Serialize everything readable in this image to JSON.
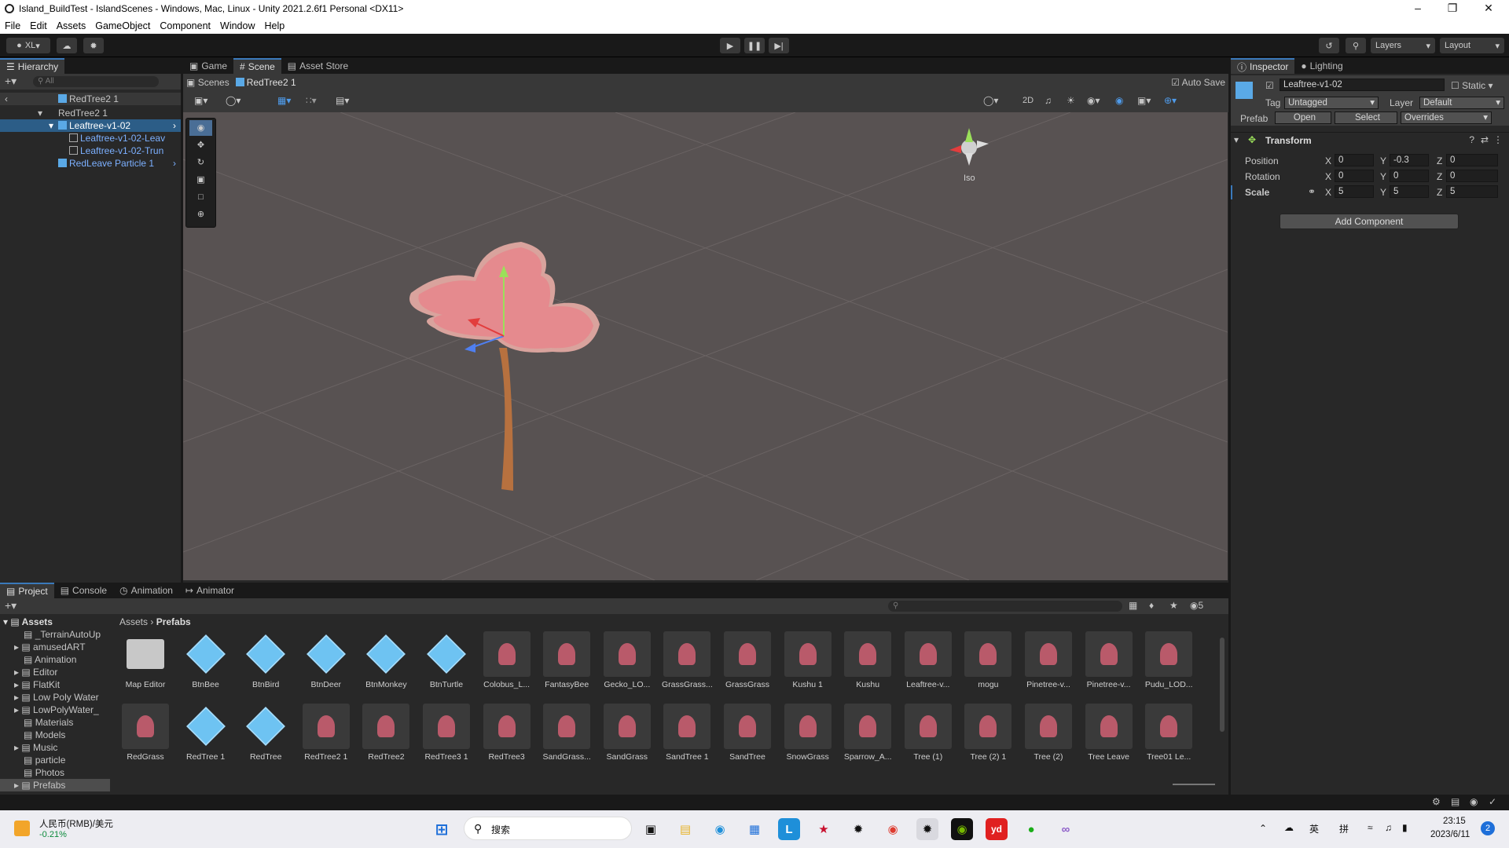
{
  "window": {
    "title": "Island_BuildTest - IslandScenes - Windows, Mac, Linux - Unity 2021.2.6f1 Personal <DX11>"
  },
  "menu": [
    "File",
    "Edit",
    "Assets",
    "GameObject",
    "Component",
    "Window",
    "Help"
  ],
  "toolbar": {
    "account": "XL",
    "layers": "Layers",
    "layout": "Layout"
  },
  "hierarchy": {
    "tab": "Hierarchy",
    "search_placeholder": "All",
    "root": "RedTree2 1",
    "items": [
      {
        "label": "RedTree2 1"
      },
      {
        "label": "Leaftree-v1-02"
      },
      {
        "label": "Leaftree-v1-02-Leav"
      },
      {
        "label": "Leaftree-v1-02-Trun"
      },
      {
        "label": "RedLeave Particle 1"
      }
    ]
  },
  "scene": {
    "tabs": [
      "Game",
      "Scene",
      "Asset Store"
    ],
    "breadcrumb": [
      "Scenes",
      "RedTree2 1"
    ],
    "auto_save": "Auto Save",
    "mode_2d": "2D",
    "iso": "Iso"
  },
  "inspector": {
    "tabs": [
      "Inspector",
      "Lighting"
    ],
    "object_name": "Leaftree-v1-02",
    "static_label": "Static",
    "tag_label": "Tag",
    "tag_value": "Untagged",
    "layer_label": "Layer",
    "layer_value": "Default",
    "prefab_label": "Prefab",
    "open": "Open",
    "select": "Select",
    "overrides": "Overrides",
    "component": "Transform",
    "position": {
      "label": "Position",
      "x": "0",
      "y": "-0.3",
      "z": "0"
    },
    "rotation": {
      "label": "Rotation",
      "x": "0",
      "y": "0",
      "z": "0"
    },
    "scale": {
      "label": "Scale",
      "x": "5",
      "y": "5",
      "z": "5"
    },
    "axis": {
      "x": "X",
      "y": "Y",
      "z": "Z"
    },
    "add_component": "Add Component"
  },
  "bottom": {
    "tabs": [
      "Project",
      "Console",
      "Animation",
      "Animator"
    ],
    "hidden_count": "5",
    "tree_root": "Assets",
    "tree": [
      "_TerrainAutoUp",
      "amusedART",
      "Animation",
      "Editor",
      "FlatKit",
      "Low Poly Water",
      "LowPolyWater_",
      "Materials",
      "Models",
      "Music",
      "particle",
      "Photos",
      "Prefabs"
    ],
    "breadcrumb": [
      "Assets",
      "Prefabs"
    ],
    "assets_row1": [
      "Map Editor",
      "BtnBee",
      "BtnBird",
      "BtnDeer",
      "BtnMonkey",
      "BtnTurtle",
      "Colobus_L...",
      "FantasyBee",
      "Gecko_LO...",
      "GrassGrass...",
      "GrassGrass",
      "Kushu 1",
      "Kushu",
      "Leaftree-v...",
      "mogu",
      "Pinetree-v...",
      "Pinetree-v...",
      "Pudu_LOD..."
    ],
    "assets_row2": [
      "RedGrass",
      "RedTree 1",
      "RedTree",
      "RedTree2 1",
      "RedTree2",
      "RedTree3 1",
      "RedTree3",
      "SandGrass...",
      "SandGrass",
      "SandTree 1",
      "SandTree",
      "SnowGrass",
      "Sparrow_A...",
      "Tree (1)",
      "Tree (2) 1",
      "Tree (2)",
      "Tree Leave",
      "Tree01 Le..."
    ]
  },
  "taskbar": {
    "widget_title": "人民币(RMB)/美元",
    "widget_value": "-0.21%",
    "search": "搜索",
    "ime1": "英",
    "ime2": "拼",
    "time": "23:15",
    "date": "2023/6/11",
    "badge": "2"
  },
  "colors": {
    "accent": "#3a79bb",
    "selection": "#2c5d87",
    "tree": "#e58a8e",
    "trunk": "#b7713f"
  }
}
